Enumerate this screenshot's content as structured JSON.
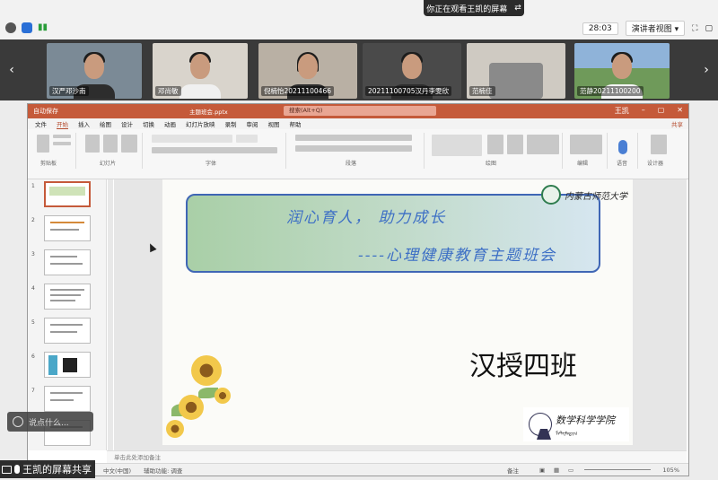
{
  "top_bar": {
    "share_notice": "你正在观看王凯的屏幕",
    "timer": "28:03",
    "view_mode": "演讲者视图"
  },
  "participants": [
    {
      "name": "汉严邓沙南"
    },
    {
      "name": "邓尚敏"
    },
    {
      "name": "倪楠怡20211100466"
    },
    {
      "name": "20211100705汉丹李雯欣"
    },
    {
      "name": "范楠佳"
    },
    {
      "name": "范静20211100200"
    }
  ],
  "ppt": {
    "title_bar": {
      "app": "自动保存",
      "filename": "主题班会.pptx",
      "search": "搜索(Alt+Q)",
      "user": "王凯"
    },
    "tabs": [
      "文件",
      "开始",
      "插入",
      "绘图",
      "设计",
      "切换",
      "动画",
      "幻灯片放映",
      "录制",
      "审阅",
      "视图",
      "帮助"
    ],
    "active_tab": "开始",
    "share_label": "共享",
    "ribbon_groups": [
      "剪贴板",
      "幻灯片",
      "字体",
      "段落",
      "绘图",
      "编辑",
      "语音",
      "设计器"
    ],
    "thumbnails": [
      {
        "num": "1"
      },
      {
        "num": "2"
      },
      {
        "num": "3"
      },
      {
        "num": "4"
      },
      {
        "num": "5"
      },
      {
        "num": "6"
      },
      {
        "num": "7"
      }
    ],
    "slide": {
      "title_line1": "润心育人， 助力成长",
      "title_line2": "----心理健康教育主题班会",
      "university_logo_text": "内蒙古师范大学",
      "class_name": "汉授四班",
      "school_logo_cn": "数学科学学院",
      "school_logo_mn": "ᠮᠠᠲᠧᠮᠠᠲᠢᠭ"
    },
    "notes_placeholder": "单击此处添加备注",
    "status": {
      "language": "中文(中国)",
      "accessibility": "辅助功能: 调查",
      "notes": "备注",
      "zoom": "105%"
    }
  },
  "chat_input": {
    "placeholder": "说点什么..."
  },
  "presenter_label": "王凯的屏幕共享"
}
